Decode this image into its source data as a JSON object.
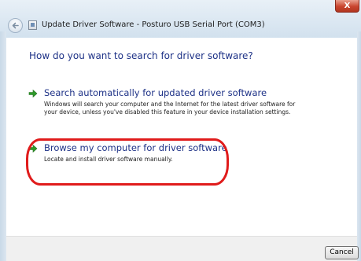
{
  "window": {
    "title": "Update Driver Software - Posturo USB Serial Port (COM3)",
    "close_label": "X"
  },
  "main": {
    "heading": "How do you want to search for driver software?",
    "options": [
      {
        "title": "Search automatically for updated driver software",
        "description": "Windows will search your computer and the Internet for the latest driver software for your device, unless you've disabled this feature in your device installation settings."
      },
      {
        "title": "Browse my computer for driver software",
        "description": "Locate and install driver software manually."
      }
    ]
  },
  "footer": {
    "cancel_label": "Cancel"
  },
  "colors": {
    "accent_text": "#1e3287",
    "arrow_green": "#2f9a2a",
    "highlight_red": "#e01b1b",
    "close_red": "#c9452e"
  },
  "icons": [
    "back-arrow-icon",
    "driver-icon",
    "green-arrow-icon",
    "close-icon"
  ]
}
